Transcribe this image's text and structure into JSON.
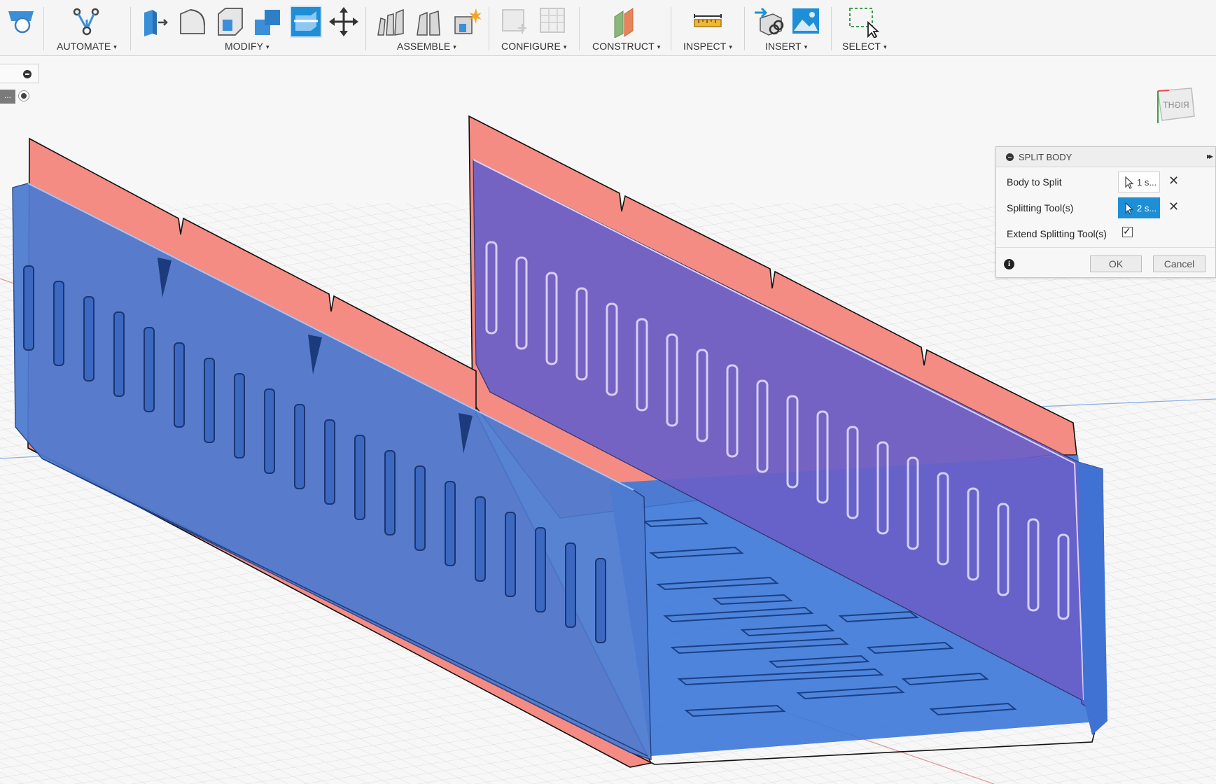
{
  "toolbar": {
    "groups": [
      {
        "label": "AUTOMATE"
      },
      {
        "label": "MODIFY"
      },
      {
        "label": "ASSEMBLE"
      },
      {
        "label": "CONFIGURE"
      },
      {
        "label": "CONSTRUCT"
      },
      {
        "label": "INSPECT"
      },
      {
        "label": "INSERT"
      },
      {
        "label": "SELECT"
      }
    ],
    "caret": "▾"
  },
  "browser": {
    "collapsed_row_text": "..."
  },
  "viewcube": {
    "face_label": "RIGHT"
  },
  "dialog": {
    "title": "SPLIT BODY",
    "expand_glyph": "▸▸",
    "body_to_split": {
      "label": "Body to Split",
      "value": "1 s..."
    },
    "splitting_tools": {
      "label": "Splitting Tool(s)",
      "value": "2 s..."
    },
    "extend_splitting_tools": {
      "label": "Extend Splitting Tool(s)",
      "checked": true,
      "tick": "✓"
    },
    "clear_glyph": "✕",
    "info_glyph": "i",
    "ok_label": "OK",
    "cancel_label": "Cancel"
  },
  "colors": {
    "selected_body": "#4d7bd1",
    "split_tool_plane": "#f58c84",
    "active_button": "#1e8fd6"
  }
}
